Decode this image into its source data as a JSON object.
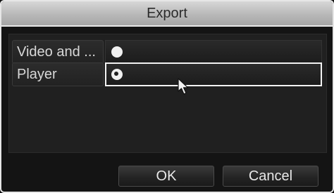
{
  "dialog": {
    "title": "Export"
  },
  "rows": [
    {
      "label": "Video and ...",
      "selected": false
    },
    {
      "label": "Player",
      "selected": true
    }
  ],
  "buttons": {
    "ok_label": "OK",
    "cancel_label": "Cancel"
  },
  "colors": {
    "title_bar": "#b8b8b8",
    "focus_outline": "#f2f2f2",
    "background": "#141414"
  },
  "icons": {
    "pointer": "mouse-pointer-icon",
    "radio": "radio-button-icon"
  }
}
